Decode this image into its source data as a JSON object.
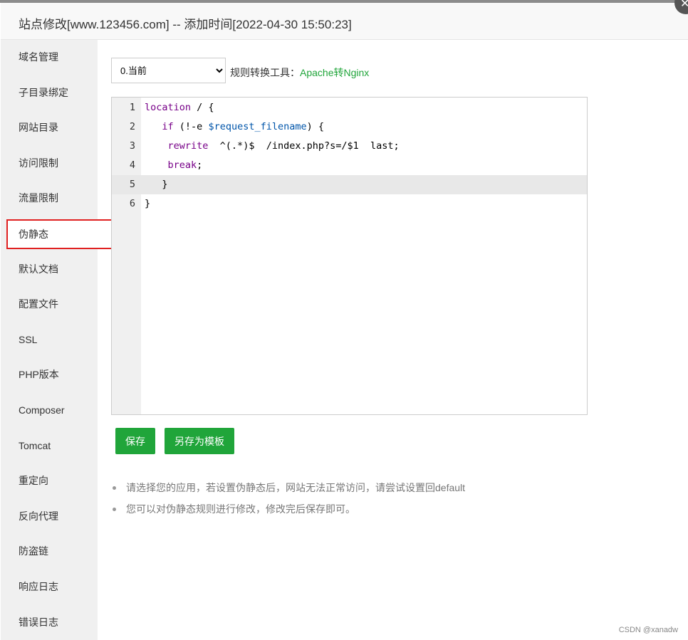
{
  "title": "站点修改[www.123456.com] -- 添加时间[2022-04-30 15:50:23]",
  "sidebar": [
    "域名管理",
    "子目录绑定",
    "网站目录",
    "访问限制",
    "流量限制",
    "伪静态",
    "默认文档",
    "配置文件",
    "SSL",
    "PHP版本",
    "Composer",
    "Tomcat",
    "重定向",
    "反向代理",
    "防盗链",
    "响应日志",
    "错误日志"
  ],
  "select": {
    "value": "0.当前"
  },
  "tool": {
    "label": "规则转换工具：",
    "link": "Apache转Nginx"
  },
  "code": {
    "numbers": [
      "1",
      "2",
      "3",
      "4",
      "5",
      "6"
    ]
  },
  "buttons": {
    "save": "保存",
    "save_template": "另存为模板"
  },
  "tips": [
    "请选择您的应用，若设置伪静态后，网站无法正常访问，请尝试设置回default",
    "您可以对伪静态规则进行修改，修改完后保存即可。"
  ],
  "watermark": "CSDN @xanadw"
}
